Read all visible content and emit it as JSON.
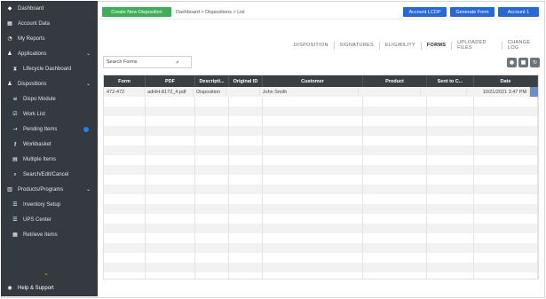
{
  "sidebar": {
    "items": [
      {
        "label": "Dashboard",
        "icon": "dashboard-icon",
        "glyph": "◆",
        "sub": false
      },
      {
        "label": "Account Data",
        "icon": "table-icon",
        "glyph": "▦",
        "sub": false
      },
      {
        "label": "My Reports",
        "icon": "report-icon",
        "glyph": "◔",
        "sub": false
      },
      {
        "label": "Applications",
        "icon": "users-icon",
        "glyph": "♟",
        "sub": false,
        "chevron": "⌄"
      },
      {
        "label": "Lifecycle Dashboard",
        "icon": "filter-icon",
        "glyph": "⧗",
        "sub": true
      },
      {
        "label": "Dispositions",
        "icon": "people-icon",
        "glyph": "♟",
        "sub": false,
        "chevron": "⌄"
      },
      {
        "label": "Dispo Module",
        "icon": "list-icon",
        "glyph": "≡",
        "sub": true
      },
      {
        "label": "Work List",
        "icon": "check-list-icon",
        "glyph": "☑",
        "sub": true
      },
      {
        "label": "Pending Items",
        "icon": "arrow-icon",
        "glyph": "→",
        "sub": true,
        "dot": true
      },
      {
        "label": "Workbasket",
        "icon": "key-icon",
        "glyph": "⚷",
        "sub": true
      },
      {
        "label": "Multiple Items",
        "icon": "clipboard-icon",
        "glyph": "▤",
        "sub": true
      },
      {
        "label": "Search/Edit/Cancel",
        "icon": "search-icon",
        "glyph": "⌕",
        "sub": true
      },
      {
        "label": "Products/Programs",
        "icon": "box-icon",
        "glyph": "▥",
        "sub": false,
        "chevron": "⌄"
      },
      {
        "label": "Inventory Setup",
        "icon": "inventory-icon",
        "glyph": "☰",
        "sub": true
      },
      {
        "label": "UPS Center",
        "icon": "lines-icon",
        "glyph": "☰",
        "sub": true
      },
      {
        "label": "Retrieve Items",
        "icon": "grid-icon",
        "glyph": "▦",
        "sub": true
      }
    ],
    "scroll_glyph": "⌄",
    "help_label": "Help & Support",
    "help_icon": "support-icon",
    "help_glyph": "◉"
  },
  "topbar": {
    "new_button_label": "Create New Disposition",
    "breadcrumb": "Dashboard > Dispositions > List",
    "buttons": [
      {
        "label": "Account LCDP",
        "icon": "document-icon"
      },
      {
        "label": "Generate Form",
        "icon": "edit-icon"
      },
      {
        "label": "Account 1",
        "icon": "gear-icon"
      }
    ]
  },
  "tabs": [
    {
      "label": "DISPOSITION",
      "active": false
    },
    {
      "label": "SIGNATURES",
      "active": false
    },
    {
      "label": "ELIGIBILITY",
      "active": false
    },
    {
      "label": "FORMS",
      "active": true
    },
    {
      "label": "UPLOADED FILES",
      "active": false
    },
    {
      "label": "CHANGE LOG",
      "active": false
    }
  ],
  "search": {
    "placeholder": "Search Forms",
    "value": "Search Forms",
    "icon_glyph": "⌕"
  },
  "toolbar": {
    "add_glyph": "●",
    "delete_glyph": "■",
    "refresh_glyph": "↻"
  },
  "grid": {
    "columns": [
      "Form",
      "PDF",
      "Descripti...",
      "Original ID",
      "Customer",
      "Product",
      "Sent to C...",
      "Date"
    ],
    "rows": [
      {
        "cells": [
          "472-472",
          "adHH-8172_4.pdf",
          "Disposition",
          "",
          "John Smith",
          "",
          "",
          "10/21/2021 3:47 PM"
        ]
      }
    ],
    "empty_rows": 19
  }
}
